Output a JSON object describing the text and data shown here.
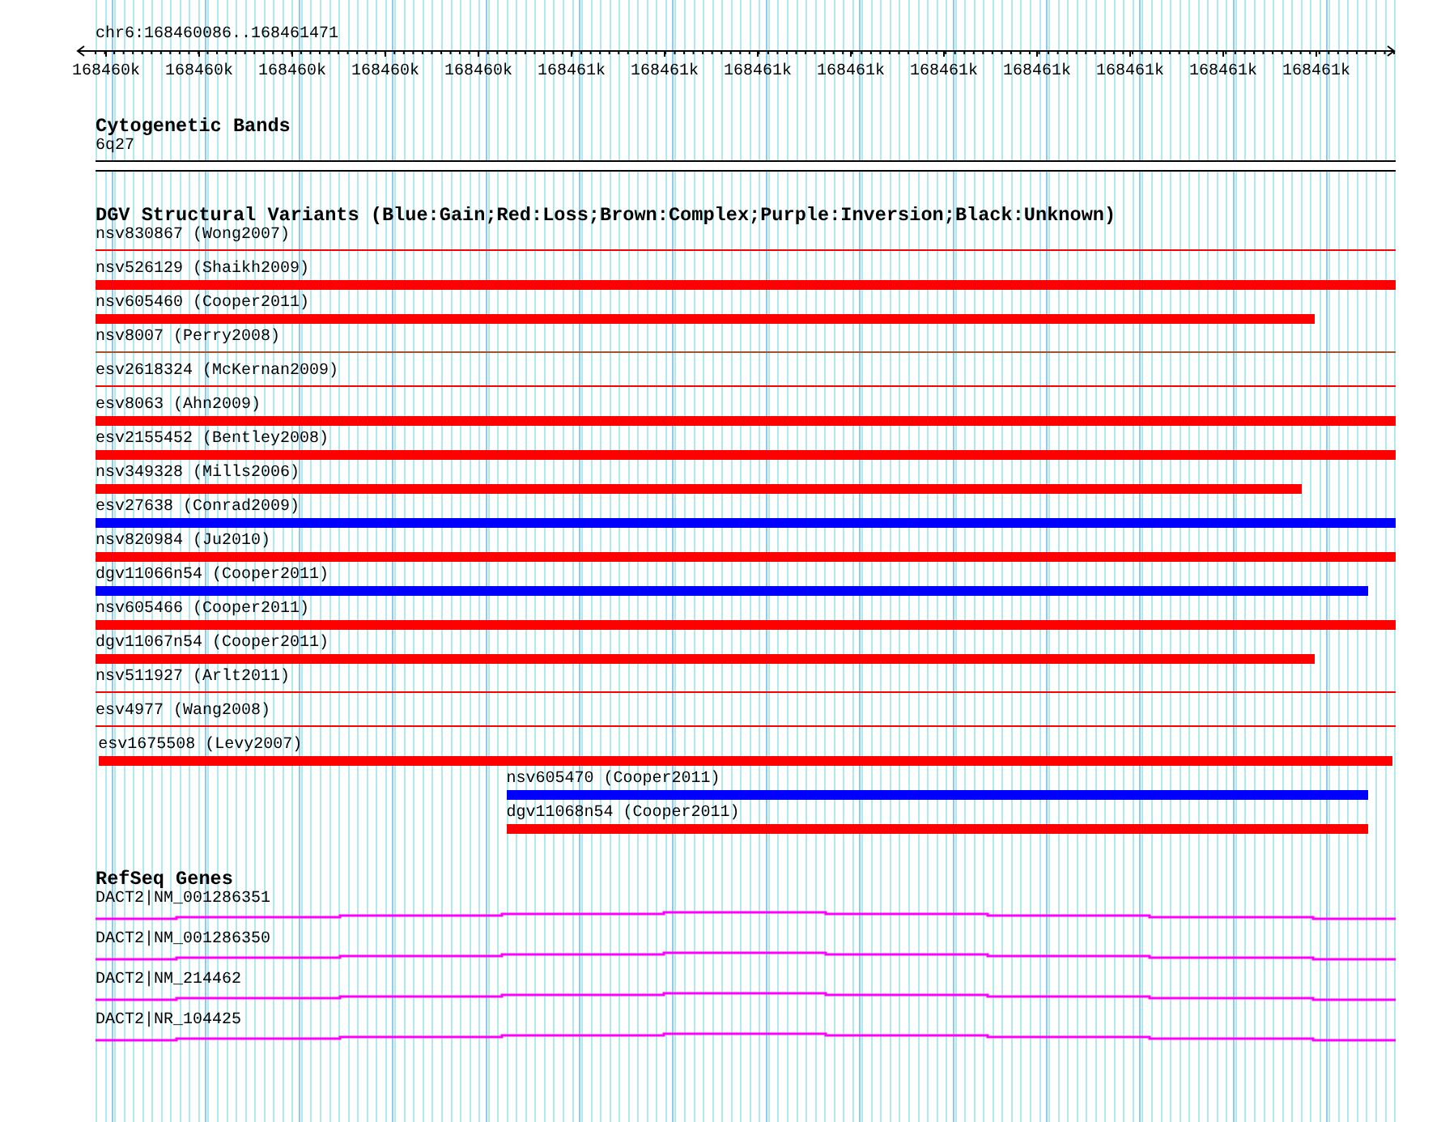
{
  "ruler": {
    "range": "chr6:168460086..168461471",
    "tick_labels": [
      "168460k",
      "168460k",
      "168460k",
      "168460k",
      "168460k",
      "168461k",
      "168461k",
      "168461k",
      "168461k",
      "168461k",
      "168461k",
      "168461k",
      "168461k",
      "168461k"
    ]
  },
  "cytogenetic_bands": {
    "title": "Cytogenetic Bands",
    "band": "6q27"
  },
  "dgv_variants": {
    "title": "DGV Structural Variants (Blue:Gain;Red:Loss;Brown:Complex;Purple:Inversion;Black:Unknown)",
    "rows": [
      {
        "label": "nsv830867 (Wong2007)",
        "color": "#ff0000",
        "kind": "line"
      },
      {
        "label": "nsv526129 (Shaikh2009)",
        "color": "#ff0000",
        "kind": "bar"
      },
      {
        "label": "nsv605460 (Cooper2011)",
        "color": "#ff0000",
        "kind": "bar"
      },
      {
        "label": "nsv8007 (Perry2008)",
        "color": "#a0522d",
        "kind": "line"
      },
      {
        "label": "esv2618324 (McKernan2009)",
        "color": "#ff0000",
        "kind": "line"
      },
      {
        "label": "esv8063 (Ahn2009)",
        "color": "#ff0000",
        "kind": "bar"
      },
      {
        "label": "esv2155452 (Bentley2008)",
        "color": "#ff0000",
        "kind": "bar"
      },
      {
        "label": "nsv349328 (Mills2006)",
        "color": "#ff0000",
        "kind": "bar"
      },
      {
        "label": "esv27638 (Conrad2009)",
        "color": "#0000ff",
        "kind": "bar"
      },
      {
        "label": "nsv820984 (Ju2010)",
        "color": "#ff0000",
        "kind": "bar"
      },
      {
        "label": "dgv11066n54 (Cooper2011)",
        "color": "#0000ff",
        "kind": "bar"
      },
      {
        "label": "nsv605466 (Cooper2011)",
        "color": "#ff0000",
        "kind": "bar"
      },
      {
        "label": "dgv11067n54 (Cooper2011)",
        "color": "#ff0000",
        "kind": "bar"
      },
      {
        "label": "nsv511927 (Arlt2011)",
        "color": "#ff0000",
        "kind": "line"
      },
      {
        "label": "esv4977 (Wang2008)",
        "color": "#ff0000",
        "kind": "line"
      },
      {
        "label": "esv1675508 (Levy2007)",
        "color": "#ff0000",
        "kind": "bar"
      },
      {
        "label": "nsv605470 (Cooper2011)",
        "color": "#0000ff",
        "kind": "bar"
      },
      {
        "label": "dgv11068n54 (Cooper2011)",
        "color": "#ff0000",
        "kind": "bar"
      }
    ]
  },
  "refseq_genes": {
    "title": "RefSeq Genes",
    "transcripts": [
      {
        "label": "DACT2|NM_001286351"
      },
      {
        "label": "DACT2|NM_001286350"
      },
      {
        "label": "DACT2|NM_214462"
      },
      {
        "label": "DACT2|NR_104425"
      }
    ]
  }
}
